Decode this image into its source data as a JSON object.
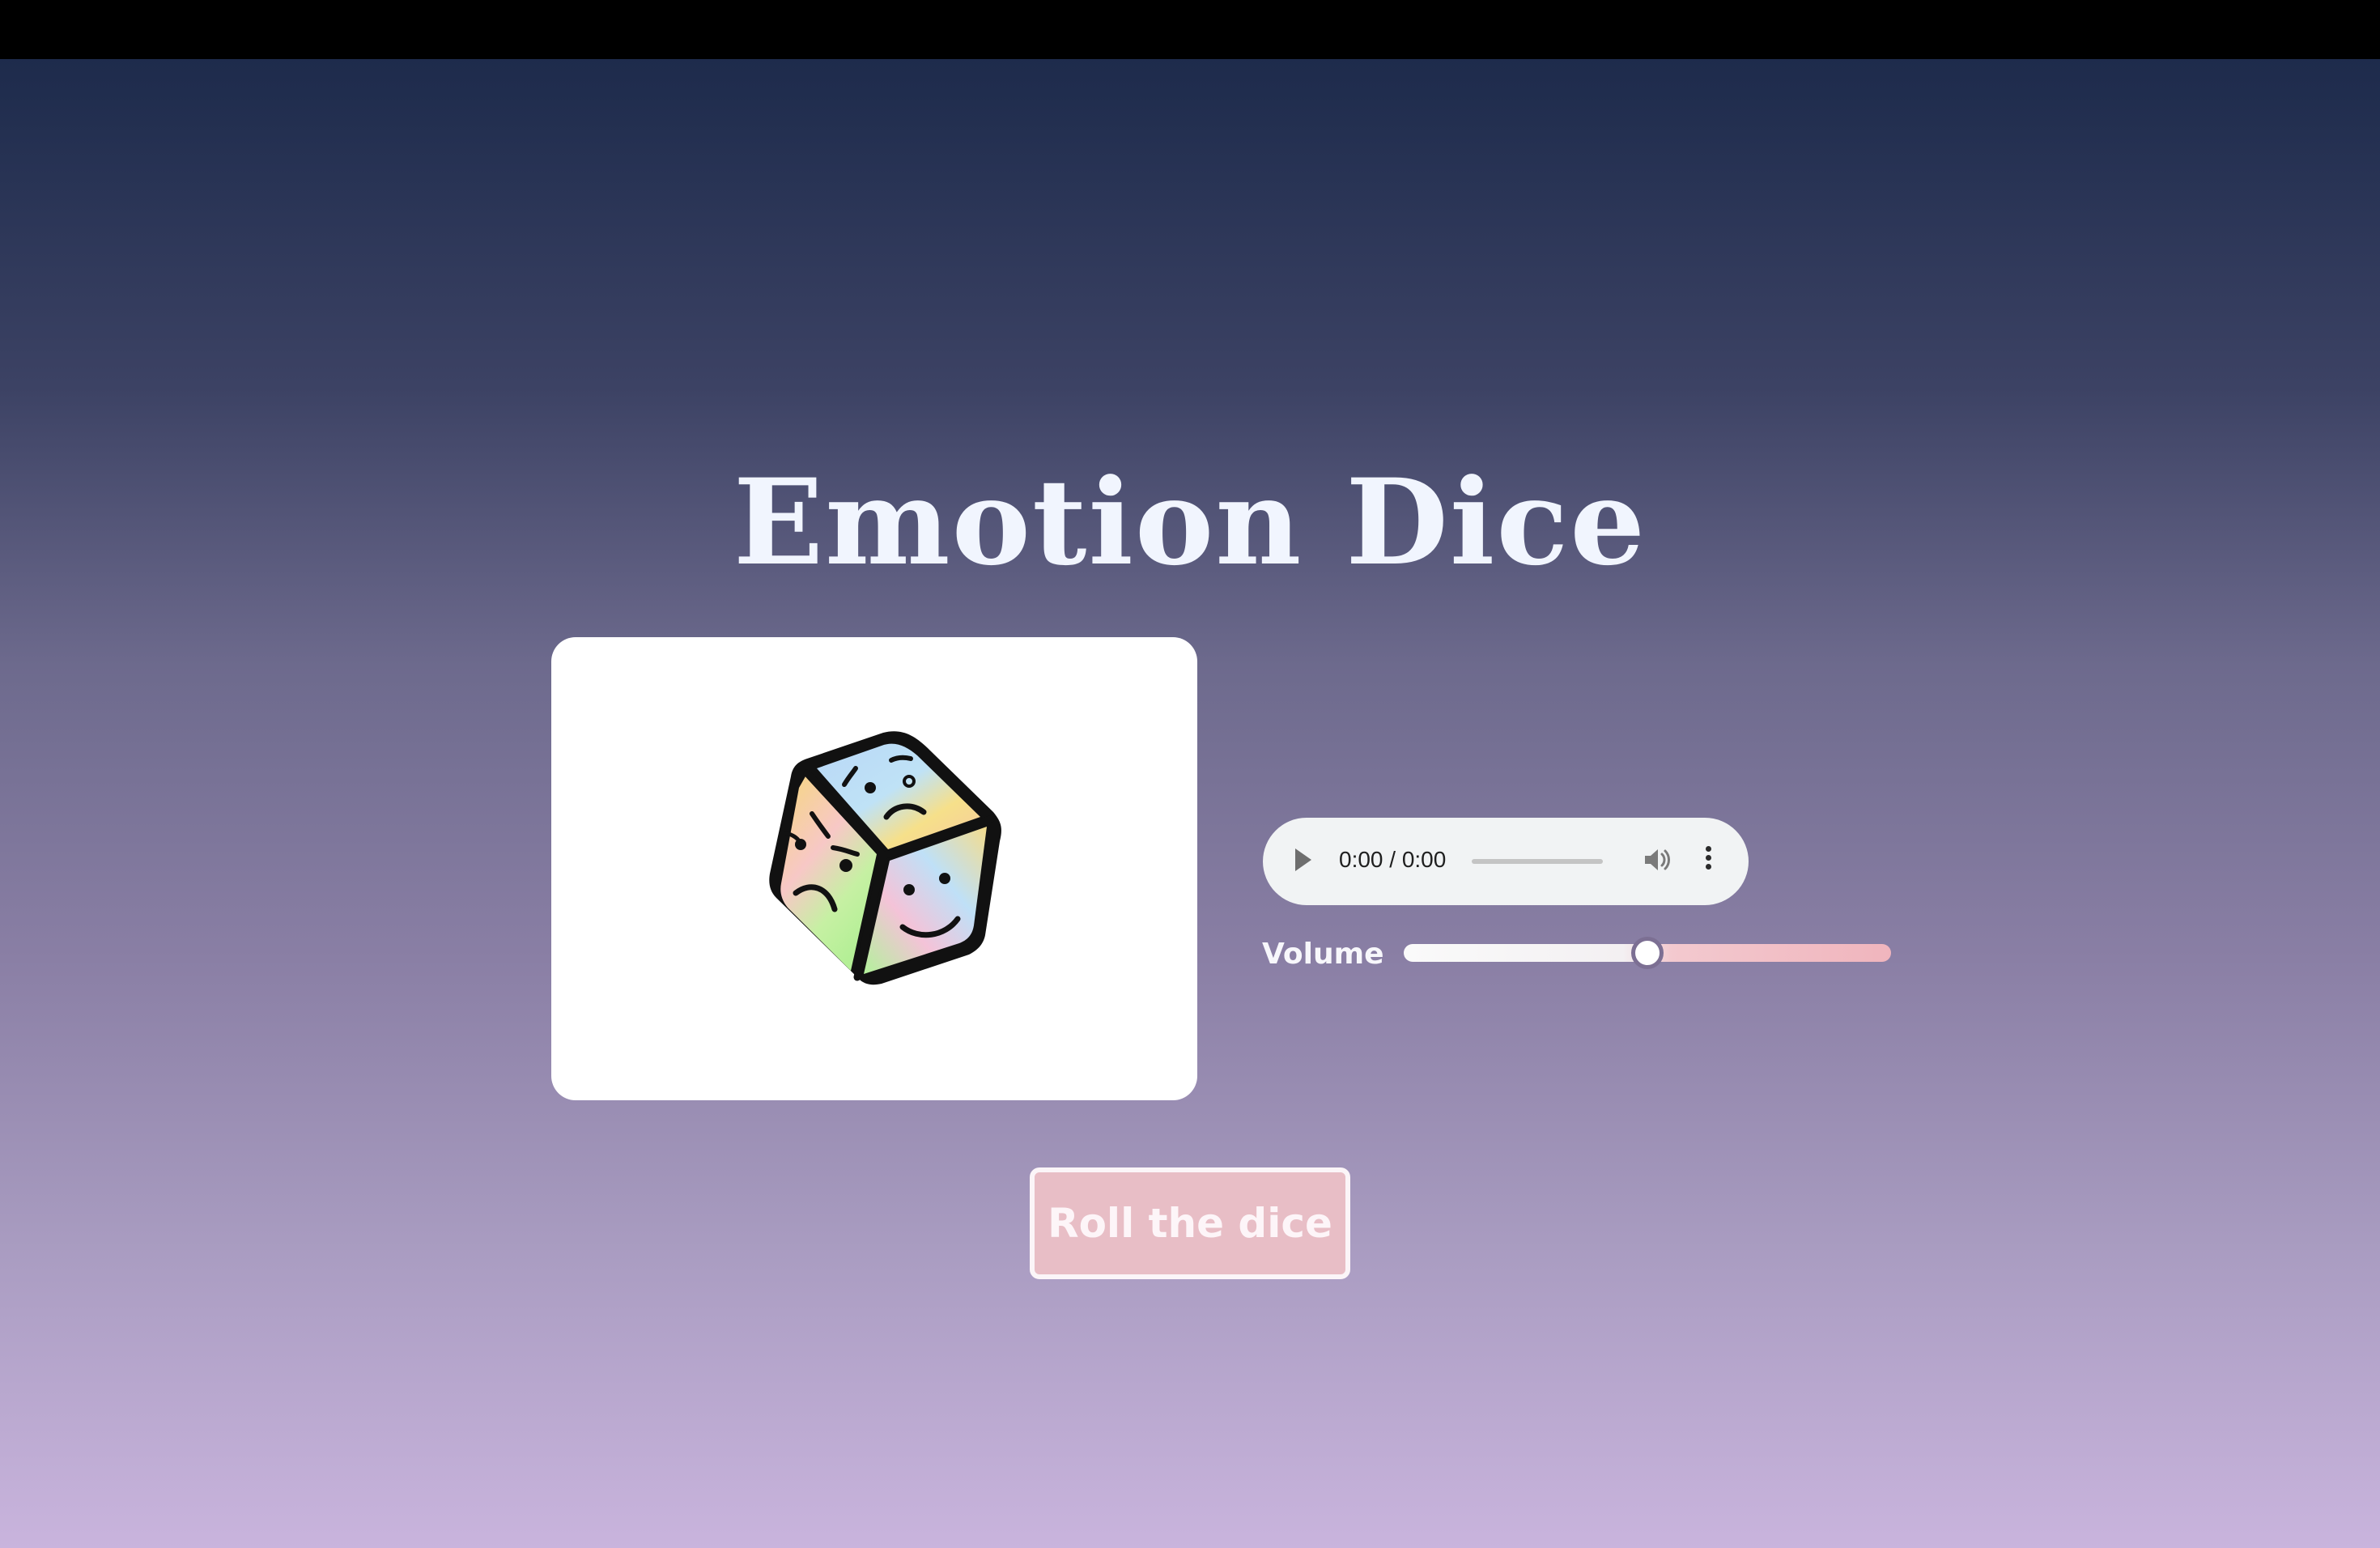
{
  "page": {
    "title": "Emotion Dice"
  },
  "dice": {
    "image_icon": "emotion-dice-icon"
  },
  "audio": {
    "time": "0:00 / 0:00",
    "play_icon": "play-icon",
    "volume_icon": "speaker-icon",
    "more_icon": "more-vertical-icon"
  },
  "volume": {
    "label": "Volume",
    "value": 0.5,
    "min": 0,
    "max": 1
  },
  "roll_button": {
    "label": "Roll the dice"
  },
  "colors": {
    "title": "#f1f5fe",
    "button_bg": "#e8bec6",
    "card_bg": "#ffffff",
    "topbar": "#000000"
  }
}
